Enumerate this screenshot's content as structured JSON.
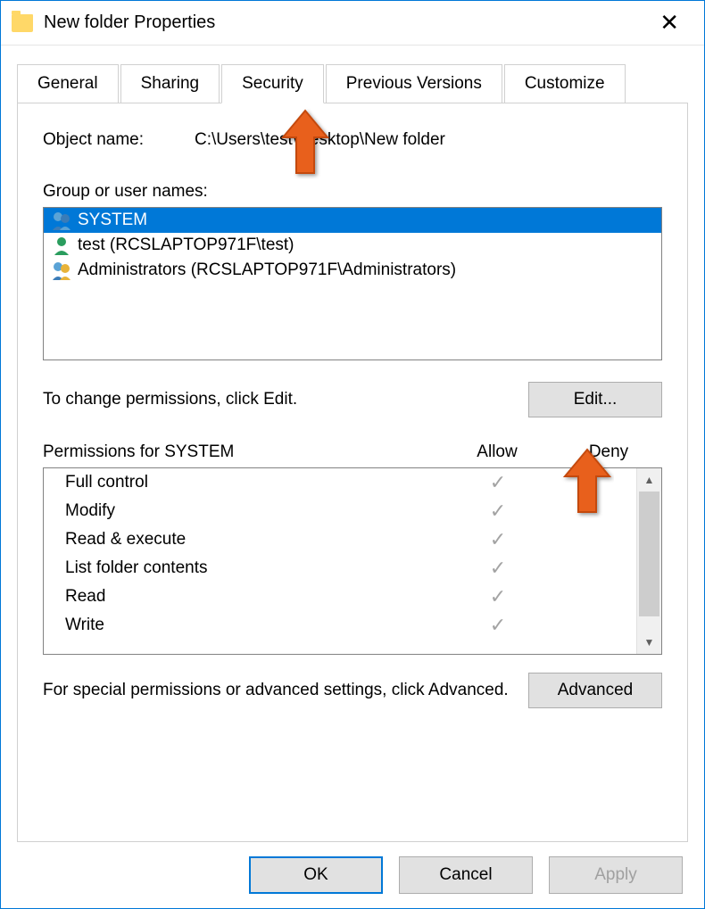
{
  "window": {
    "title": "New folder Properties"
  },
  "tabs": {
    "items": [
      {
        "label": "General",
        "active": false
      },
      {
        "label": "Sharing",
        "active": false
      },
      {
        "label": "Security",
        "active": true
      },
      {
        "label": "Previous Versions",
        "active": false
      },
      {
        "label": "Customize",
        "active": false
      }
    ]
  },
  "object": {
    "label": "Object name:",
    "path": "C:\\Users\\test\\Desktop\\New folder"
  },
  "groups": {
    "label": "Group or user names:",
    "items": [
      {
        "name": "SYSTEM",
        "selected": true,
        "iconType": "two"
      },
      {
        "name": "test (RCSLAPTOP971F\\test)",
        "selected": false,
        "iconType": "one"
      },
      {
        "name": "Administrators (RCSLAPTOP971F\\Administrators)",
        "selected": false,
        "iconType": "admins"
      }
    ]
  },
  "editRow": {
    "text": "To change permissions, click Edit.",
    "button": "Edit..."
  },
  "permissions": {
    "header": {
      "title": "Permissions for SYSTEM",
      "allow": "Allow",
      "deny": "Deny"
    },
    "items": [
      {
        "name": "Full control",
        "allow": true
      },
      {
        "name": "Modify",
        "allow": true
      },
      {
        "name": "Read & execute",
        "allow": true
      },
      {
        "name": "List folder contents",
        "allow": true
      },
      {
        "name": "Read",
        "allow": true
      },
      {
        "name": "Write",
        "allow": true
      }
    ]
  },
  "advanced": {
    "text": "For special permissions or advanced settings, click Advanced.",
    "button": "Advanced"
  },
  "buttons": {
    "ok": "OK",
    "cancel": "Cancel",
    "apply": "Apply"
  }
}
